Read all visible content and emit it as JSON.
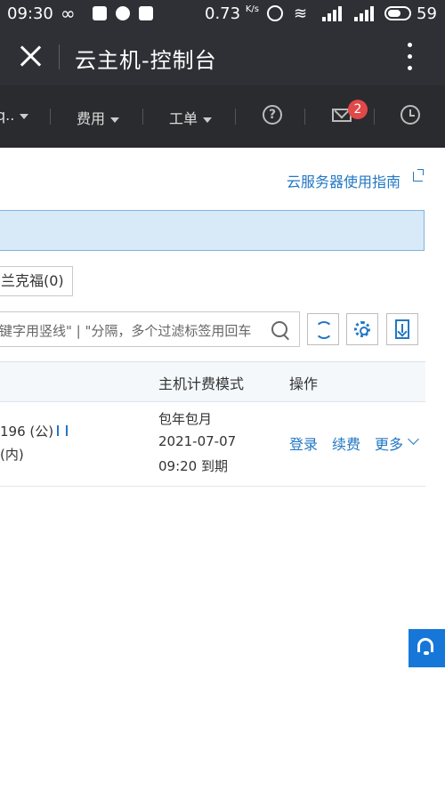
{
  "status_bar": {
    "time": "09:30",
    "infinity": "∞",
    "speed": "0.73",
    "speed_unit": "K/s",
    "battery_pct": "59",
    "battery_level": 0.59
  },
  "title_bar": {
    "title": "云主机-控制台",
    "close_icon": "close-icon",
    "menu_icon": "more-vertical-icon"
  },
  "nav": {
    "item_cut": "q..",
    "fee_label": "费用",
    "ticket_label": "工单",
    "help_glyph": "?",
    "mail_badge": "2"
  },
  "content": {
    "guide_link": "云服务器使用指南",
    "region_tab": "兰克福(0)",
    "search_placeholder": "键字用竖线\" | \"分隔，多个过滤标签用回车",
    "table": {
      "headers": [
        "主机计费模式",
        "操作"
      ],
      "rows": [
        {
          "ip_public": "196 (公)",
          "ip_private": "(内)",
          "billing_mode": "包年包月",
          "expire_date": "2021-07-07",
          "expire_time": "09:20 到期",
          "action_login": "登录",
          "action_renew": "续费",
          "action_more": "更多"
        }
      ]
    }
  },
  "colors": {
    "header_bg": "#2e3035",
    "nav_bg": "#2a2b2e",
    "accent": "#2277c4",
    "banner_bg": "#d8e9f7",
    "badge_red": "#e24848",
    "fab_blue": "#1677d9"
  }
}
